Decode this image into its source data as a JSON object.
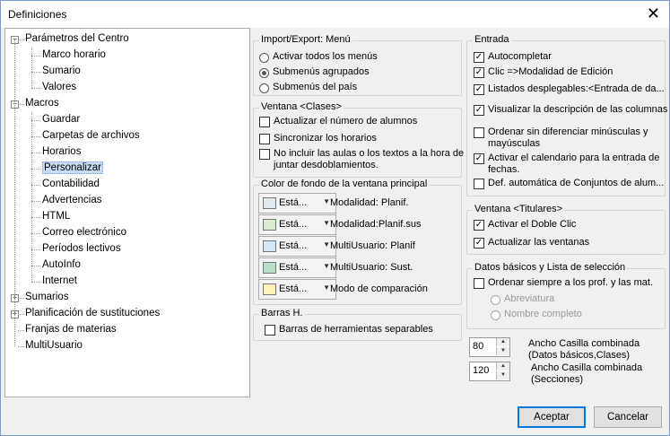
{
  "window": {
    "title": "Definiciones"
  },
  "tree": [
    {
      "label": "Parámetros del Centro",
      "level": 0,
      "expander": "−"
    },
    {
      "label": "Marco horario",
      "level": 1
    },
    {
      "label": "Sumario",
      "level": 1
    },
    {
      "label": "Valores",
      "level": 1
    },
    {
      "label": "Macros",
      "level": 0,
      "expander": "−"
    },
    {
      "label": "Guardar",
      "level": 1
    },
    {
      "label": "Carpetas de archivos",
      "level": 1
    },
    {
      "label": "Horarios",
      "level": 1
    },
    {
      "label": "Personalizar",
      "level": 1,
      "selected": true
    },
    {
      "label": "Contabilidad",
      "level": 1
    },
    {
      "label": "Advertencias",
      "level": 1
    },
    {
      "label": "HTML",
      "level": 1
    },
    {
      "label": "Correo electrónico",
      "level": 1
    },
    {
      "label": "Períodos lectivos",
      "level": 1
    },
    {
      "label": "AutoInfo",
      "level": 1
    },
    {
      "label": "Internet",
      "level": 1
    },
    {
      "label": "Sumarios",
      "level": 0,
      "expander": "+"
    },
    {
      "label": "Planificación de sustituciones",
      "level": 0,
      "expander": "+"
    },
    {
      "label": "Franjas de materias",
      "level": 0
    },
    {
      "label": "MultiUsuario",
      "level": 0
    }
  ],
  "import_export": {
    "title": "Import/Export: Menú",
    "options": [
      {
        "label": "Activar todos los menús",
        "selected": false
      },
      {
        "label": "Submenús agrupados",
        "selected": true
      },
      {
        "label": "Submenús del país",
        "selected": false
      }
    ]
  },
  "ventana_clases": {
    "title": "Ventana <Clases>",
    "checks": [
      {
        "label": "Actualizar el número de alumnos",
        "checked": false
      },
      {
        "label": "Sincronizar los horarios",
        "checked": false
      },
      {
        "label": "No incluir las aulas o los textos a la hora de",
        "label2": "juntar desdoblamientos.",
        "checked": false
      }
    ]
  },
  "color_fondo": {
    "title": "Color de fondo de la ventana principal",
    "items": [
      {
        "button": "Está...",
        "label": "Modalidad: Planif.",
        "color": "#e2e8f0"
      },
      {
        "button": "Está...",
        "label": "Modalidad:Planif.sus",
        "color": "#d8ecd0"
      },
      {
        "button": "Está...",
        "label": "MultiUsuario: Planif",
        "color": "#d6e8f6"
      },
      {
        "button": "Está...",
        "label": "MultiUsuario: Sust.",
        "color": "#b8dcc8"
      },
      {
        "button": "Está...",
        "label": "Modo de comparación",
        "color": "#fff3b8"
      }
    ]
  },
  "barras": {
    "title": "Barras H.",
    "checks": [
      {
        "label": "Barras de herramientas separables",
        "checked": false
      }
    ]
  },
  "entrada": {
    "title": "Entrada",
    "checks": [
      {
        "label": "Autocompletar",
        "checked": true
      },
      {
        "label": "Clic =>Modalidad de Edición",
        "checked": true
      },
      {
        "label": "Listados desplegables:<Entrada de da...",
        "checked": true
      },
      {
        "label": "Visualizar la descripción de las columnas",
        "checked": true
      },
      {
        "label": "Ordenar sin diferenciar minúsculas y",
        "label2": "mayúsculas",
        "checked": false
      },
      {
        "label": "Activar el calendario para la entrada de",
        "label2": "fechas.",
        "checked": true
      },
      {
        "label": "Def. automática de Conjuntos de alum...",
        "checked": false
      }
    ]
  },
  "ventana_titulares": {
    "title": "Ventana <Titulares>",
    "checks": [
      {
        "label": "Activar el Doble Clic",
        "checked": true
      },
      {
        "label": "Actualizar las ventanas",
        "checked": true
      }
    ]
  },
  "datos_basicos": {
    "title": "Datos básicos y Lista de selección",
    "check": {
      "label": "Ordenar siempre a los prof. y las mat.",
      "checked": false
    },
    "radios": [
      {
        "label": "Abreviatura"
      },
      {
        "label": "Nombre completo"
      }
    ]
  },
  "spinners": [
    {
      "value": "80",
      "label": "Ancho Casilla combinada",
      "label2": "(Datos básicos,Clases)"
    },
    {
      "value": "120",
      "label": "Ancho Casilla combinada",
      "label2": "(Secciones)"
    }
  ],
  "buttons": {
    "ok": "Aceptar",
    "cancel": "Cancelar"
  }
}
